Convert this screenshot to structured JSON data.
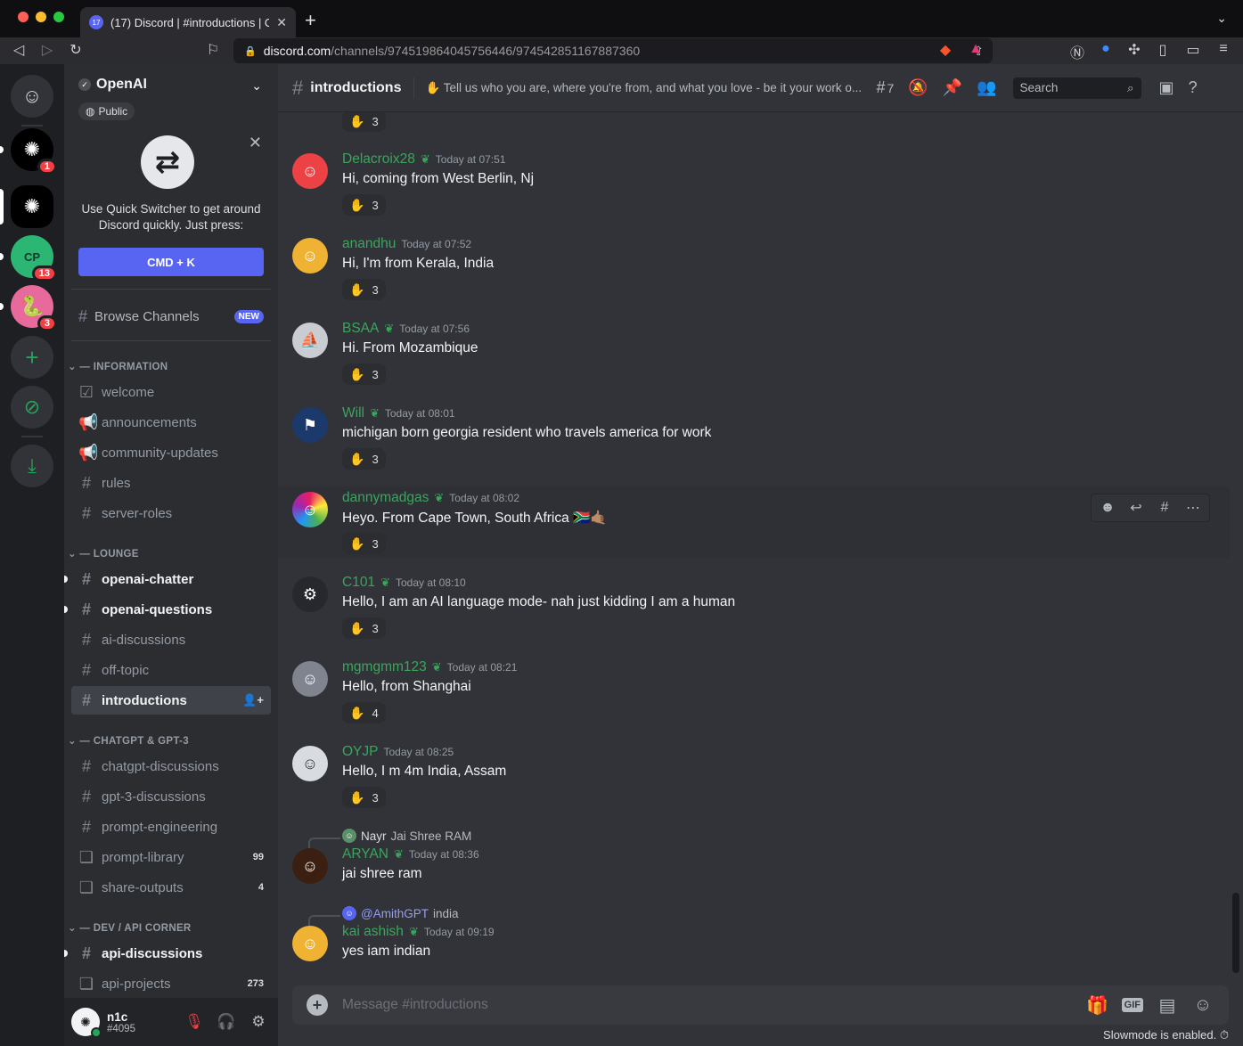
{
  "browser": {
    "tab_title": "(17) Discord | #introductions | O",
    "tab_favicon_count": "17",
    "url_host": "discord.com",
    "url_path": "/channels/974519864045756446/974542851167887360"
  },
  "servers": [
    {
      "name": "Discord Home",
      "icon": "discord-icon",
      "badge": ""
    },
    {
      "name": "OpenAI",
      "icon": "openai-icon",
      "badge": "1"
    },
    {
      "name": "OpenAI (active)",
      "icon": "openai-icon",
      "badge": ""
    },
    {
      "name": "CP",
      "icon": "cp-icon",
      "badge": "13"
    },
    {
      "name": "Python",
      "icon": "python-icon",
      "badge": "3"
    }
  ],
  "server": {
    "name": "OpenAI",
    "public_label": "Public"
  },
  "quick_switcher": {
    "text": "Use Quick Switcher to get around Discord quickly. Just press:",
    "button": "CMD + K"
  },
  "browse": {
    "label": "Browse Channels",
    "badge": "NEW"
  },
  "categories": {
    "information": "INFORMATION",
    "lounge": "LOUNGE",
    "chatgpt": "CHATGPT & GPT-3",
    "dev": "DEV / API CORNER"
  },
  "channels": {
    "welcome": "welcome",
    "announcements": "announcements",
    "community_updates": "community-updates",
    "rules": "rules",
    "server_roles": "server-roles",
    "openai_chatter": "openai-chatter",
    "openai_questions": "openai-questions",
    "ai_discussions": "ai-discussions",
    "off_topic": "off-topic",
    "introductions": "introductions",
    "chatgpt_discussions": "chatgpt-discussions",
    "gpt3_discussions": "gpt-3-discussions",
    "prompt_engineering": "prompt-engineering",
    "prompt_library": "prompt-library",
    "prompt_library_count": "99",
    "share_outputs": "share-outputs",
    "share_outputs_count": "4",
    "api_discussions": "api-discussions",
    "api_projects": "api-projects",
    "api_projects_count": "273"
  },
  "user": {
    "name": "n1c",
    "tag": "#4095"
  },
  "header": {
    "channel": "introductions",
    "topic": "Tell us who you are, where you're from, and what you love - be it your work o...",
    "threads_count": "7",
    "search_placeholder": "Search"
  },
  "messages": [
    {
      "author": "Delacroix28",
      "time": "Today at 07:51",
      "text": "Hi, coming from West Berlin, Nj",
      "reaction": "3"
    },
    {
      "author": "anandhu",
      "time": "Today at 07:52",
      "text": "Hi, I'm from Kerala, India",
      "reaction": "3"
    },
    {
      "author": "BSAA",
      "time": "Today at 07:56",
      "text": "Hi. From Mozambique",
      "reaction": "3"
    },
    {
      "author": "Will",
      "time": "Today at 08:01",
      "text": "michigan born georgia resident who travels america for work",
      "reaction": "3"
    },
    {
      "author": "dannymadgas",
      "time": "Today at 08:02",
      "text": "Heyo. From Cape Town, South Africa 🇿🇦🤙🏽",
      "reaction": "3"
    },
    {
      "author": "C101",
      "time": "Today at 08:10",
      "text": "Hello, I am an AI language mode- nah just kidding I am a human",
      "reaction": "3"
    },
    {
      "author": "mgmgmm123",
      "time": "Today at 08:21",
      "text": "Hello, from Shanghai",
      "reaction": "4"
    },
    {
      "author": "OYJP",
      "time": "Today at 08:25",
      "text": "Hello, I m 4m India, Assam",
      "reaction": "3"
    },
    {
      "author": "ARYAN",
      "time": "Today at 08:36",
      "text": "jai shree ram",
      "reply_name": "Nayr",
      "reply_text": "Jai Shree RAM"
    },
    {
      "author": "kai ashish",
      "time": "Today at 09:19",
      "text": "yes iam indian",
      "reply_name": "@AmithGPT",
      "reply_text": "india"
    }
  ],
  "top_reaction": "3",
  "composer": {
    "placeholder": "Message #introductions",
    "gif_label": "GIF",
    "slowmode": "Slowmode is enabled."
  },
  "colors": {
    "accent": "#5865f2",
    "role_green": "#3ba55d",
    "badge_red": "#f23f43"
  }
}
